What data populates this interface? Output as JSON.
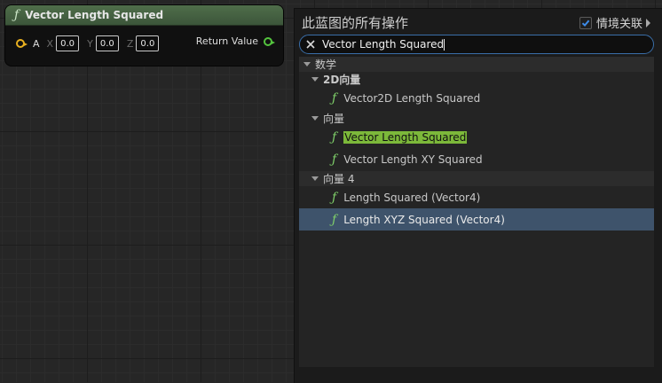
{
  "node": {
    "title": "Vector Length Squared",
    "fn_icon": "function-icon",
    "input_pin_label": "A",
    "axes": [
      {
        "label": "X",
        "value": "0.0"
      },
      {
        "label": "Y",
        "value": "0.0"
      },
      {
        "label": "Z",
        "value": "0.0"
      }
    ],
    "return_label": "Return Value",
    "colors": {
      "header": "#4f6e4a",
      "input_pin": "#e8b020",
      "output_pin": "#54c43e"
    }
  },
  "menu": {
    "title": "此蓝图的所有操作",
    "context_sensitive_label": "情境关联",
    "context_sensitive_checked": true,
    "search": {
      "value": "Vector Length Squared"
    },
    "tree": {
      "root": "数学",
      "groups": [
        {
          "label": "2D向量",
          "items": [
            "Vector2D Length Squared"
          ]
        },
        {
          "label": "向量",
          "items": [
            "Vector Length Squared",
            "Vector Length XY Squared"
          ]
        },
        {
          "label": "向量 4",
          "items": [
            "Length Squared (Vector4)",
            "Length XYZ Squared (Vector4)"
          ]
        }
      ]
    },
    "colors": {
      "selection": "#3e536b",
      "match_highlight": "#7cb83a",
      "search_border": "#3a6ea8",
      "checkbox": "#3d8be8"
    }
  }
}
